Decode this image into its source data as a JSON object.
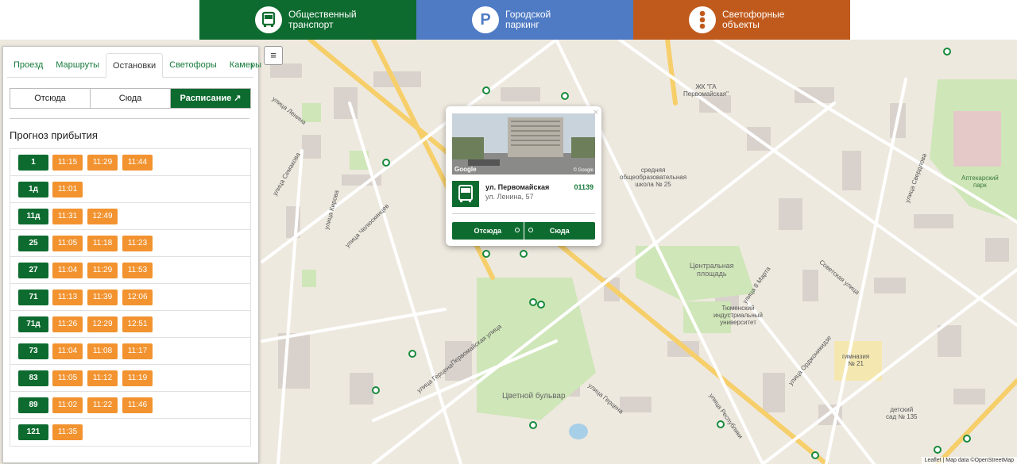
{
  "topnav": [
    {
      "label": "Общественный\nтранспорт",
      "icon": "bus-icon"
    },
    {
      "label": "Городской\nпаркинг",
      "icon": "parking-icon"
    },
    {
      "label": "Светофорные\nобъекты",
      "icon": "traffic-light-icon"
    }
  ],
  "panel": {
    "tabs": [
      "Проезд",
      "Маршруты",
      "Остановки",
      "Светофоры",
      "Камеры"
    ],
    "active_tab": "Остановки",
    "segments": [
      "Отсюда",
      "Сюда",
      "Расписание"
    ],
    "forecast_title": "Прогноз прибытия",
    "routes": [
      {
        "route": "1",
        "times": [
          "11:15",
          "11:29",
          "11:44"
        ]
      },
      {
        "route": "1д",
        "times": [
          "11:01"
        ]
      },
      {
        "route": "11д",
        "times": [
          "11:31",
          "12:49"
        ]
      },
      {
        "route": "25",
        "times": [
          "11:05",
          "11:18",
          "11:23"
        ]
      },
      {
        "route": "27",
        "times": [
          "11:04",
          "11:29",
          "11:53"
        ]
      },
      {
        "route": "71",
        "times": [
          "11:13",
          "11:39",
          "12:06"
        ]
      },
      {
        "route": "71д",
        "times": [
          "11:26",
          "12:29",
          "12:51"
        ]
      },
      {
        "route": "73",
        "times": [
          "11:04",
          "11:08",
          "11:17"
        ]
      },
      {
        "route": "83",
        "times": [
          "11:05",
          "11:12",
          "11:19"
        ]
      },
      {
        "route": "89",
        "times": [
          "11:02",
          "11:22",
          "11:46"
        ]
      },
      {
        "route": "121",
        "times": [
          "11:35"
        ]
      }
    ]
  },
  "popup": {
    "photo_brand": "Google",
    "photo_copyright": "© Google",
    "stop_name": "ул. Первомайская",
    "stop_code": "01139",
    "stop_address": "ул. Ленина, 57",
    "btn_from": "Отсюда",
    "btn_to": "Сюда"
  },
  "map": {
    "labels": {
      "lenina": "улица Ленина",
      "pervomayskaya": "Первомайская улица",
      "gertsena1": "улица Герцена",
      "gertsena2": "улица Герцена",
      "chelyuskintsev": "улица Челюскинцев",
      "respubliki": "улица Республики",
      "sovetskaya": "Советская улица",
      "ordzhonikidze": "улица Орджоникидзе",
      "kirova": "улица Кирова",
      "semakova": "улица Семакова",
      "tsvetnoy": "Цветной бульвар",
      "ploshad": "Центральная\nплощадь",
      "university": "Тюменский\nиндустриальный\nуниверситет",
      "school": "средняя\nобщеобразовательная\nшкола № 25",
      "gymnasium": "гимназия\n№ 21",
      "kindergarten": "детский\nсад № 135",
      "apteka": "Аптекарский\nпарк",
      "zhk": "ЖК \"ГА\nПервомайская\"",
      "sverdlova": "улица Свердлова",
      "marta": "улица 8 Марта"
    },
    "attribution": "Leaflet | Map data ©OpenStreetMap"
  }
}
